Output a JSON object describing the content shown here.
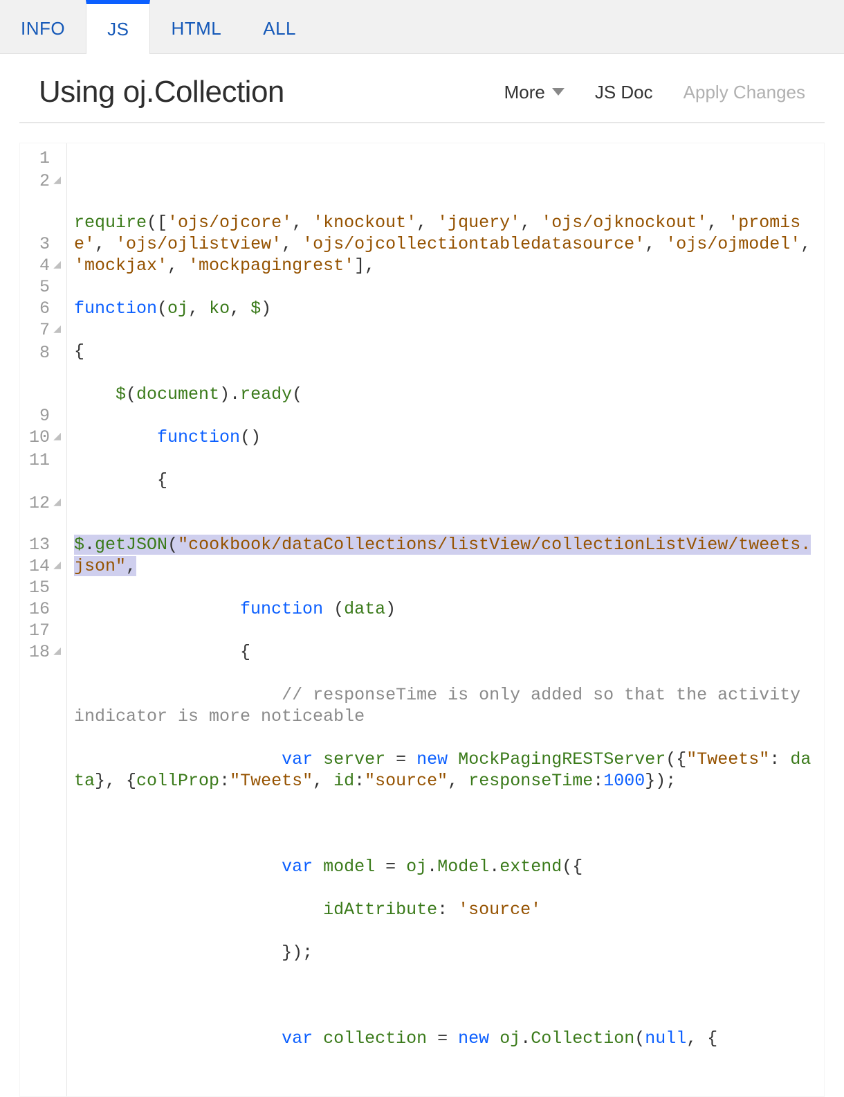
{
  "tabs": {
    "info": "INFO",
    "js": "JS",
    "html": "HTML",
    "all": "ALL",
    "active": "js"
  },
  "header": {
    "title": "Using oj.Collection",
    "more_label": "More",
    "jsdoc_label": "JS Doc",
    "apply_label": "Apply Changes"
  },
  "editor": {
    "gutter": [
      "1",
      "2",
      "3",
      "4",
      "5",
      "6",
      "7",
      "8",
      "9",
      "10",
      "11",
      "12",
      "13",
      "14",
      "15",
      "16",
      "17",
      "18"
    ],
    "code": {
      "l1": "",
      "l2_require": "require",
      "l2_s1": "'ojs/ojcore'",
      "l2_s2": "'knockout'",
      "l2_s3": "'jquery'",
      "l2_s4": "'ojs/ojknockout'",
      "l2_s5": "'promise'",
      "l2_s6": "'ojs/ojlistview'",
      "l2_s7": "'ojs/ojcollectiontabledatasource'",
      "l2_s8": "'ojs/ojmodel'",
      "l2_s9": "'mockjax'",
      "l2_s10": "'mockpagingrest'",
      "l3_function": "function",
      "l3_p1": "oj",
      "l3_p2": "ko",
      "l3_p3": "$",
      "l4": "{",
      "l5_dollar": "$",
      "l5_doc": "document",
      "l5_ready": "ready",
      "l6_function": "function",
      "l7": "{",
      "l8_dollar": "$",
      "l8_getjson": "getJSON",
      "l8_url": "\"cookbook/dataCollections/listView/collectionListView/tweets.json\"",
      "l9_function": "function",
      "l9_data": "data",
      "l10": "{",
      "l11_comment": "// responseTime is only added so that the activity indicator is more noticeable",
      "l12_var": "var",
      "l12_server": "server",
      "l12_new": "new",
      "l12_mock": "MockPagingRESTServer",
      "l12_tweets1": "\"Tweets\"",
      "l12_data": "data",
      "l12_collprop": "collProp",
      "l12_tweets2": "\"Tweets\"",
      "l12_id": "id",
      "l12_source": "\"source\"",
      "l12_rt": "responseTime",
      "l12_1000": "1000",
      "l14_var": "var",
      "l14_model": "model",
      "l14_oj": "oj",
      "l14_Model": "Model",
      "l14_extend": "extend",
      "l15_idattr": "idAttribute",
      "l15_source": "'source'",
      "l16": "});",
      "l18_var": "var",
      "l18_coll": "collection",
      "l18_new": "new",
      "l18_oj": "oj",
      "l18_Collection": "Collection",
      "l18_null": "null"
    }
  }
}
